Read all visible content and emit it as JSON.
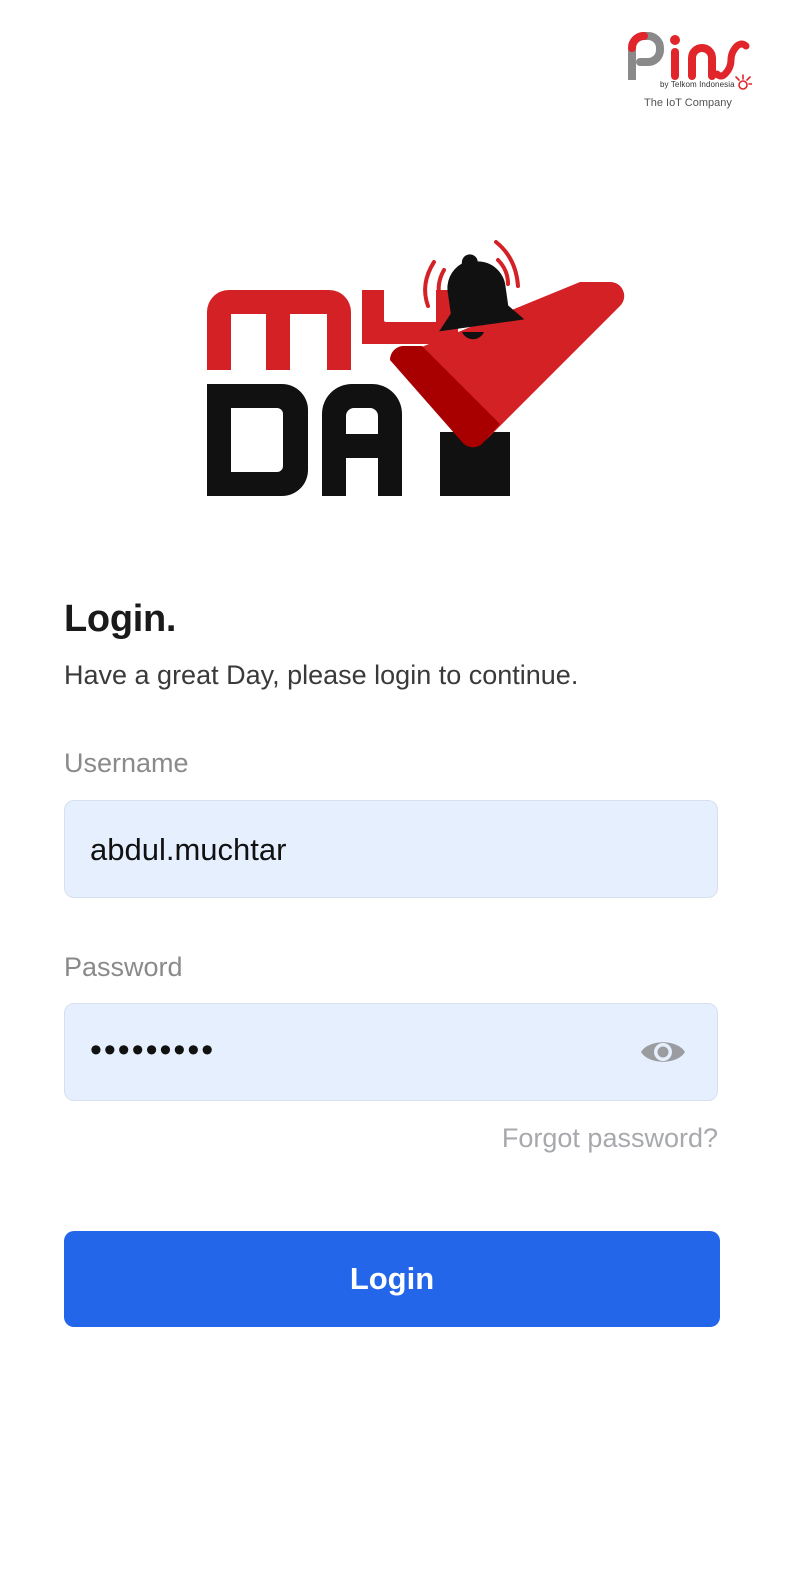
{
  "partner_logo": {
    "brand": "pins",
    "byline": "by Telkom Indonesia",
    "tagline": "The IoT Company",
    "colors": {
      "red": "#e0252b",
      "gray": "#8a8a8a"
    }
  },
  "app_logo": {
    "top_word": "MY",
    "bottom_word": "DAY",
    "icons": [
      "bell-icon",
      "checkmark-icon"
    ],
    "colors": {
      "red": "#d42126",
      "dark_red": "#a80000",
      "black": "#111111"
    }
  },
  "login": {
    "title": "Login.",
    "subtitle": "Have a great Day, please login to continue."
  },
  "form": {
    "username": {
      "label": "Username",
      "value": "abdul.muchtar"
    },
    "password": {
      "label": "Password",
      "masked_value": "•••••••••",
      "toggle_icon": "eye-icon"
    },
    "forgot_password": "Forgot password?",
    "submit_label": "Login"
  },
  "theme": {
    "primary": "#2466ea",
    "input_bg": "#e6effd",
    "label_color": "#8a8a8a",
    "muted_link": "#a7a9ad"
  }
}
